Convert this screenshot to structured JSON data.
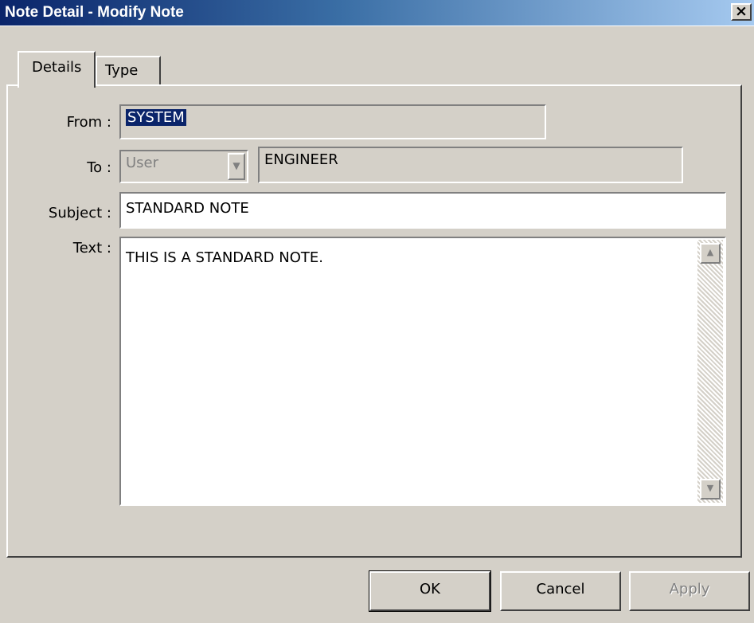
{
  "window": {
    "title": "Note Detail - Modify Note",
    "close_glyph": "×",
    "titlebar_color": "#0a246a"
  },
  "tabs": [
    {
      "label": "Details",
      "active": true
    },
    {
      "label": "Type",
      "active": false
    }
  ],
  "form": {
    "from_label": "From :",
    "from_value": "SYSTEM",
    "to_label": "To :",
    "to_type_value": "User",
    "to_value": "ENGINEER",
    "subject_label": "Subject :",
    "subject_value": "STANDARD NOTE",
    "text_label": "Text :",
    "text_value": "THIS IS A STANDARD NOTE."
  },
  "buttons": {
    "ok": "OK",
    "cancel": "Cancel",
    "apply": "Apply"
  },
  "icons": {
    "close": "close-icon",
    "combo": "chevron-down-icon",
    "scroll_up": "scroll-up-icon",
    "scroll_down": "scroll-down-icon"
  }
}
